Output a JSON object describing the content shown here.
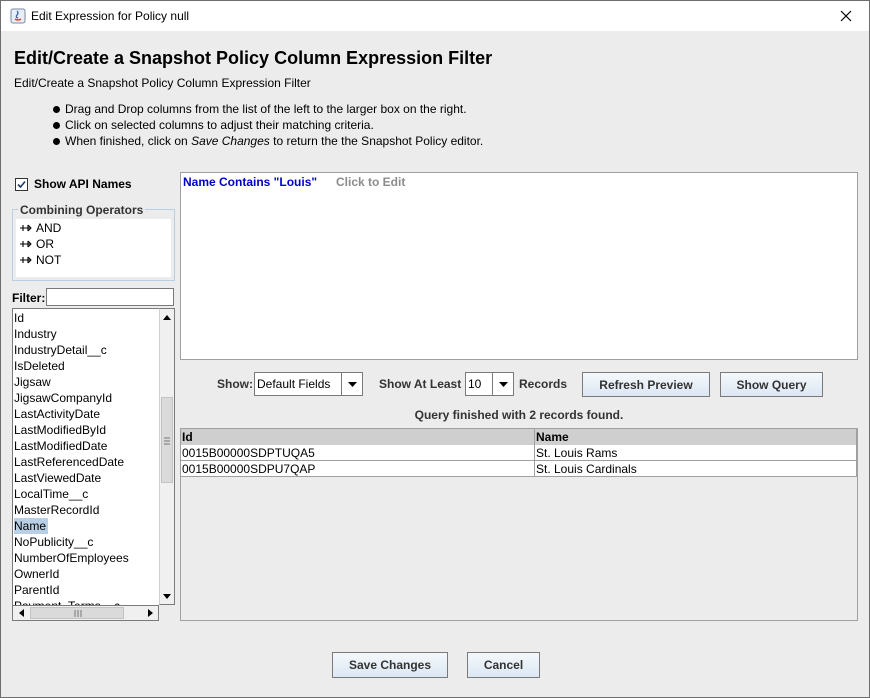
{
  "window": {
    "title": "Edit Expression for Policy null",
    "close_glyph": "✕"
  },
  "header": {
    "heading": "Edit/Create a Snapshot Policy Column Expression Filter",
    "subheading": "Edit/Create a Snapshot Policy Column Expression Filter"
  },
  "instructions": {
    "line1": "Drag and Drop columns from the list of the left to the larger box on the right.",
    "line2": "Click on selected columns to adjust their matching criteria.",
    "line3_prefix": "When finished, click on ",
    "line3_emphasis": "Save Changes",
    "line3_suffix": " to return the the Snapshot Policy editor."
  },
  "sidebar": {
    "show_api_names_label": "Show API Names",
    "show_api_names_checked": true,
    "operators_title": "Combining Operators",
    "operators": [
      "AND",
      "OR",
      "NOT"
    ],
    "filter_label": "Filter:",
    "filter_value": "",
    "fields": [
      "Id",
      "Industry",
      "IndustryDetail__c",
      "IsDeleted",
      "Jigsaw",
      "JigsawCompanyId",
      "LastActivityDate",
      "LastModifiedById",
      "LastModifiedDate",
      "LastReferencedDate",
      "LastViewedDate",
      "LocalTime__c",
      "MasterRecordId",
      "Name",
      "NoPublicity__c",
      "NumberOfEmployees",
      "OwnerId",
      "ParentId",
      "Payment_Terms__c"
    ],
    "selected_field": "Name"
  },
  "expression": {
    "text": "Name Contains \"Louis\"",
    "edit_hint": "Click to Edit",
    "text_color": "#0000c8"
  },
  "controls": {
    "show_label": "Show:",
    "show_value": "Default Fields",
    "show_at_least_label": "Show At Least",
    "records_value": "10",
    "records_label": "Records",
    "refresh_button": "Refresh Preview",
    "show_query_button": "Show Query"
  },
  "results": {
    "status": "Query finished with 2 records found.",
    "columns": [
      "Id",
      "Name"
    ],
    "rows": [
      [
        "0015B00000SDPTUQA5",
        "St. Louis Rams"
      ],
      [
        "0015B00000SDPU7QAP",
        "St. Louis Cardinals"
      ]
    ]
  },
  "footer": {
    "save_button": "Save Changes",
    "cancel_button": "Cancel"
  },
  "colors": {
    "window_bg": "#ececec",
    "selection": "#b8cfe5",
    "button_gradient_end": "#dce7f3"
  }
}
